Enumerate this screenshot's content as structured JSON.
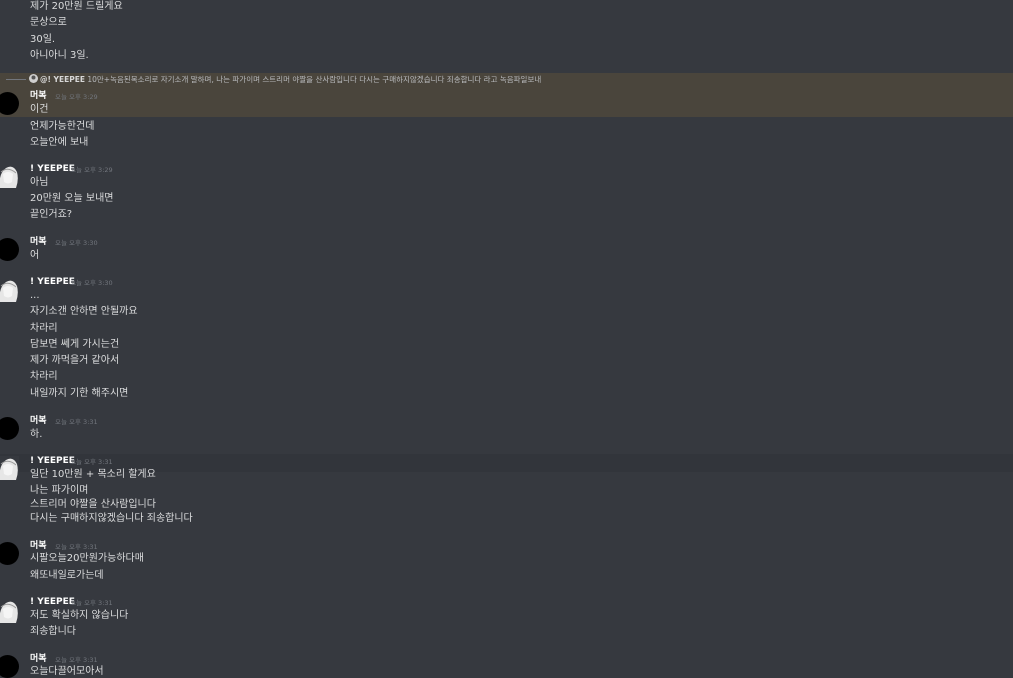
{
  "top_lines": [
    "제가 20만원 드릴게요",
    "문상으로",
    "30일.",
    "아니아니 3일."
  ],
  "reply": {
    "author": "@! YEEPEE",
    "text": "10만+녹음된목소리로 자기소개 말하며, 나는 파가이며 스트리머 야짤을 산사람입니다 다시는 구매하지않겠습니다 죄송합니다 라고 녹음파일보내"
  },
  "messages": [
    {
      "author": "머복",
      "time": "오늘 오후 3:29",
      "lines": [
        "이건",
        "언제가능한건데",
        "오늘안에 보내"
      ]
    },
    {
      "author": "! YEEPEE",
      "time": "오늘 오후 3:29",
      "lines": [
        "아님",
        "20만원 오늘 보내면",
        "끝인거죠?"
      ]
    },
    {
      "author": "머복",
      "time": "오늘 오후 3:30",
      "lines": [
        "어"
      ]
    },
    {
      "author": "! YEEPEE",
      "time": "오늘 오후 3:30",
      "lines": [
        "...",
        "자기소갠 안하면 안될까요",
        "차라리",
        "담보면 쎄게 가시는건",
        "제가 까먹을거 같아서",
        "차라리",
        "내일까지 기한 해주시면"
      ]
    },
    {
      "author": "머복",
      "time": "오늘 오후 3:31",
      "lines": [
        "하."
      ]
    },
    {
      "author": "! YEEPEE",
      "time": "오늘 오후 3:31",
      "lines": [
        "일단 10만원 + 목소리 할게요",
        "나는 파가이며",
        "스트리머 야짤을 산사람입니다",
        "다시는 구매하지않겠습니다 죄송합니다"
      ]
    },
    {
      "author": "머복",
      "time": "오늘 오후 3:31",
      "lines": [
        "시팔오늘20만원가능하다매",
        "왜또내일로가는데"
      ]
    },
    {
      "author": "! YEEPEE",
      "time": "오늘 오후 3:31",
      "lines": [
        "저도 확실하지 않습니다",
        "죄송합니다"
      ]
    },
    {
      "author": "머복",
      "time": "오늘 오후 3:31",
      "lines": [
        "오늘다끌어모아서"
      ]
    }
  ]
}
